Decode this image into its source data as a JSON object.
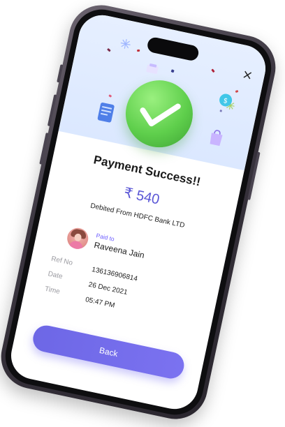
{
  "screen": {
    "title": "Payment Success!!",
    "amount": "₹ 540",
    "debited_from": "Debited From HDFC Bank LTD",
    "close_icon": "×"
  },
  "payee": {
    "label": "Paid to",
    "name": "Raveena Jain"
  },
  "details": [
    {
      "label": "Ref No",
      "value": "136136906814"
    },
    {
      "label": "Date",
      "value": "26 Dec 2021"
    },
    {
      "label": "Time",
      "value": "05:47 PM"
    }
  ],
  "actions": {
    "back_label": "Back"
  },
  "colors": {
    "accent": "#6d67e6",
    "success": "#5fcf4c",
    "hero_bg": "#e6efff"
  },
  "icons": {
    "close": "close-icon",
    "success": "check-icon",
    "avatar": "avatar"
  }
}
